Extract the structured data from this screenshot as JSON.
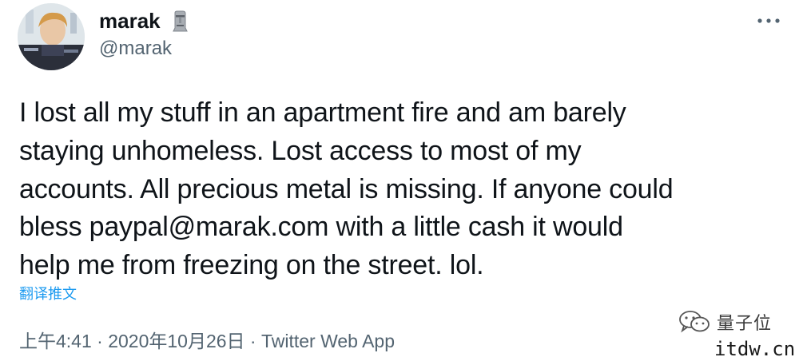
{
  "tweet": {
    "author": {
      "name": "marak",
      "handle": "@marak",
      "badge_icon": "moai-icon",
      "avatar_icon": "avatar"
    },
    "more_icon": "more-icon",
    "text_lines": [
      "I lost all my stuff in an apartment fire and am barely",
      "staying unhomeless. Lost access to most of my",
      "accounts. All precious metal is missing. If anyone could",
      "bless paypal@marak.com with a little cash it would",
      "help me from freezing on the street. lol."
    ],
    "translate_label": "翻译推文",
    "timestamp": "上午4:41 · 2020年10月26日 · Twitter Web App"
  },
  "watermark": {
    "text": "量子位",
    "icon": "wechat-icon"
  },
  "site_mark": "itdw.cn",
  "colors": {
    "text": "#0f1419",
    "secondary": "#536471",
    "link": "#1d9bf0",
    "background": "#ffffff"
  }
}
